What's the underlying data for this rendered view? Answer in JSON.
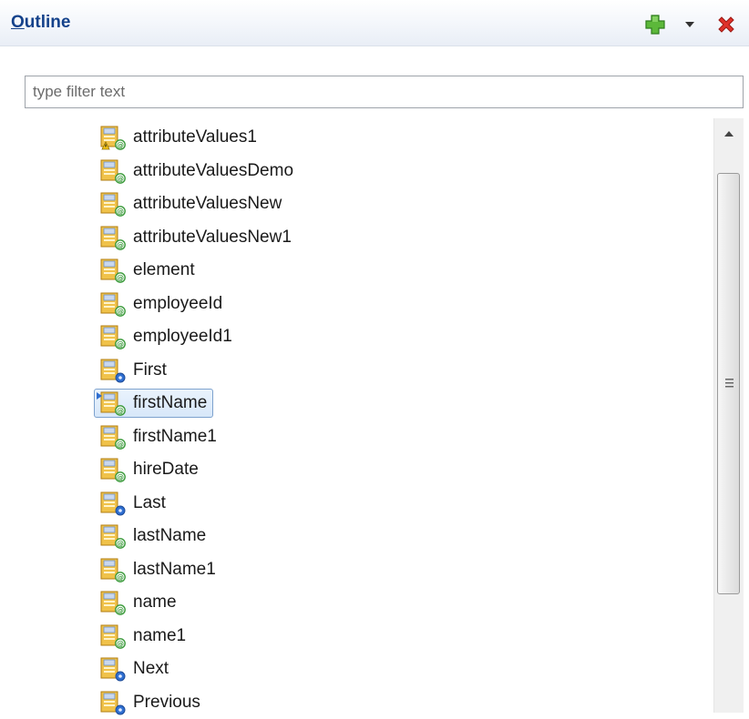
{
  "panel": {
    "title_mnemonic": "O",
    "title_rest": "utline",
    "toolbar": {
      "add_icon": "green-plus-icon",
      "menu_icon": "view-menu-dropdown-icon",
      "close_icon": "red-x-icon"
    }
  },
  "filter": {
    "value": "",
    "placeholder": "type filter text"
  },
  "tree": {
    "items": [
      {
        "label": "attributeValues1",
        "icon": "attribute-warning-icon",
        "selected": false
      },
      {
        "label": "attributeValuesDemo",
        "icon": "attribute-icon",
        "selected": false
      },
      {
        "label": "attributeValuesNew",
        "icon": "attribute-icon",
        "selected": false
      },
      {
        "label": "attributeValuesNew1",
        "icon": "attribute-icon",
        "selected": false
      },
      {
        "label": "element",
        "icon": "attribute-icon",
        "selected": false
      },
      {
        "label": "employeeId",
        "icon": "attribute-icon",
        "selected": false
      },
      {
        "label": "employeeId1",
        "icon": "attribute-icon",
        "selected": false
      },
      {
        "label": "First",
        "icon": "action-gear-icon",
        "selected": false
      },
      {
        "label": "firstName",
        "icon": "attribute-icon",
        "selected": true
      },
      {
        "label": "firstName1",
        "icon": "attribute-icon",
        "selected": false
      },
      {
        "label": "hireDate",
        "icon": "attribute-icon",
        "selected": false
      },
      {
        "label": "Last",
        "icon": "action-gear-icon",
        "selected": false
      },
      {
        "label": "lastName",
        "icon": "attribute-icon",
        "selected": false
      },
      {
        "label": "lastName1",
        "icon": "attribute-icon",
        "selected": false
      },
      {
        "label": "name",
        "icon": "attribute-icon",
        "selected": false
      },
      {
        "label": "name1",
        "icon": "attribute-icon",
        "selected": false
      },
      {
        "label": "Next",
        "icon": "action-gear-icon",
        "selected": false
      },
      {
        "label": "Previous",
        "icon": "action-gear-icon",
        "selected": false
      }
    ]
  },
  "colors": {
    "title": "#15428b",
    "selection_border": "#7da2ce",
    "selection_fill": "#d7e7f9",
    "icon_folder": "#f0c24a",
    "icon_attribute": "#3a9a3a",
    "icon_gear": "#2f6fd1"
  }
}
